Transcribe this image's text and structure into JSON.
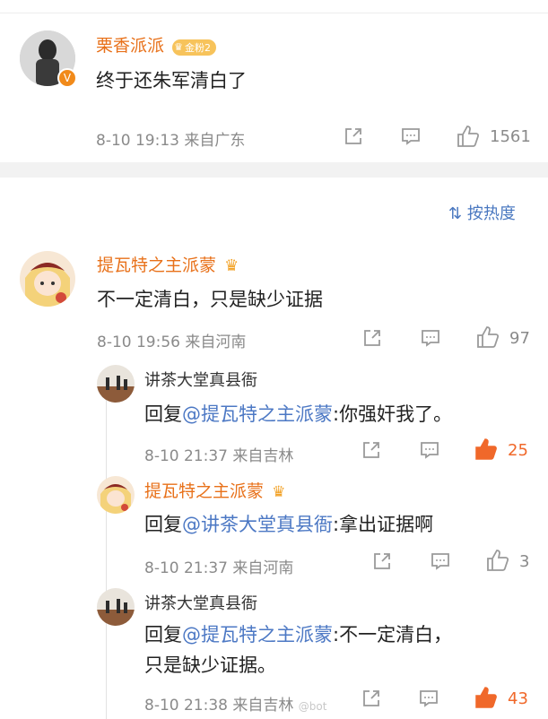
{
  "post": {
    "user": "栗香派派",
    "fan_badge": "金粉2",
    "text": "终于还朱军清白了",
    "time": "8-10 19:13",
    "from": "来自广东",
    "likes": "1561"
  },
  "sort": {
    "label": "按热度"
  },
  "comment": {
    "user": "提瓦特之主派蒙",
    "text": "不一定清白，只是缺少证据",
    "time": "8-10 19:56",
    "from": "来自河南",
    "likes": "97"
  },
  "replies": [
    {
      "user": "讲茶大堂真县衙",
      "reply_prefix": "回复",
      "mention": "@提瓦特之主派蒙",
      "text": ":你强奸我了。",
      "time": "8-10 21:37",
      "from": "来自吉林",
      "likes": "25"
    },
    {
      "user": "提瓦特之主派蒙",
      "reply_prefix": "回复",
      "mention": "@讲茶大堂真县衙",
      "text": ":拿出证据啊",
      "time": "8-10 21:37",
      "from": "来自河南",
      "likes": "3"
    },
    {
      "user": "讲茶大堂真县衙",
      "reply_prefix": "回复",
      "mention": "@提瓦特之主派蒙",
      "text": ":不一定清白，",
      "text2": "只是缺少证据。",
      "time": "8-10 21:38",
      "from": "来自吉林",
      "likes": "43"
    }
  ],
  "watermark": "@bot",
  "colors": {
    "orange": "#e8711a",
    "link": "#4c78c4",
    "hot": "#f0682a"
  }
}
